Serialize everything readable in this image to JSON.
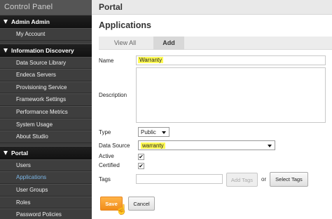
{
  "sidebar": {
    "title": "Control Panel",
    "sections": [
      {
        "label": "Admin Admin",
        "items": [
          {
            "label": "My Account"
          }
        ]
      },
      {
        "label": "Information Discovery",
        "items": [
          {
            "label": "Data Source Library"
          },
          {
            "label": "Endeca Servers"
          },
          {
            "label": "Provisioning Service"
          },
          {
            "label": "Framework Settings"
          },
          {
            "label": "Performance Metrics"
          },
          {
            "label": "System Usage"
          },
          {
            "label": "About Studio"
          }
        ]
      },
      {
        "label": "Portal",
        "items": [
          {
            "label": "Users"
          },
          {
            "label": "Applications",
            "active": true
          },
          {
            "label": "User Groups"
          },
          {
            "label": "Roles"
          },
          {
            "label": "Password Policies"
          }
        ]
      }
    ]
  },
  "header": {
    "title": "Portal"
  },
  "page": {
    "title": "Applications",
    "tabs": [
      {
        "label": "View All"
      },
      {
        "label": "Add",
        "active": true
      }
    ]
  },
  "form": {
    "name_label": "Name",
    "name_value": "Warranty",
    "description_label": "Description",
    "description_value": "",
    "type_label": "Type",
    "type_value": "Public",
    "data_source_label": "Data Source",
    "data_source_value": "warranty",
    "active_label": "Active",
    "active_checked": true,
    "certified_label": "Certified",
    "certified_checked": true,
    "tags_label": "Tags",
    "tags_value": "",
    "add_tags_label": "Add Tags",
    "or_label": "or",
    "select_tags_label": "Select Tags",
    "save_label": "Save",
    "cancel_label": "Cancel",
    "check_glyph": "✔"
  },
  "colors": {
    "highlight": "#fffa55",
    "save": "#f08c1a",
    "sidebar": "#3d3d3d",
    "active_link": "#7db8e8"
  },
  "icons": {
    "section_toggle": "triangle-down-icon",
    "pointer": "hand-cursor-icon"
  }
}
